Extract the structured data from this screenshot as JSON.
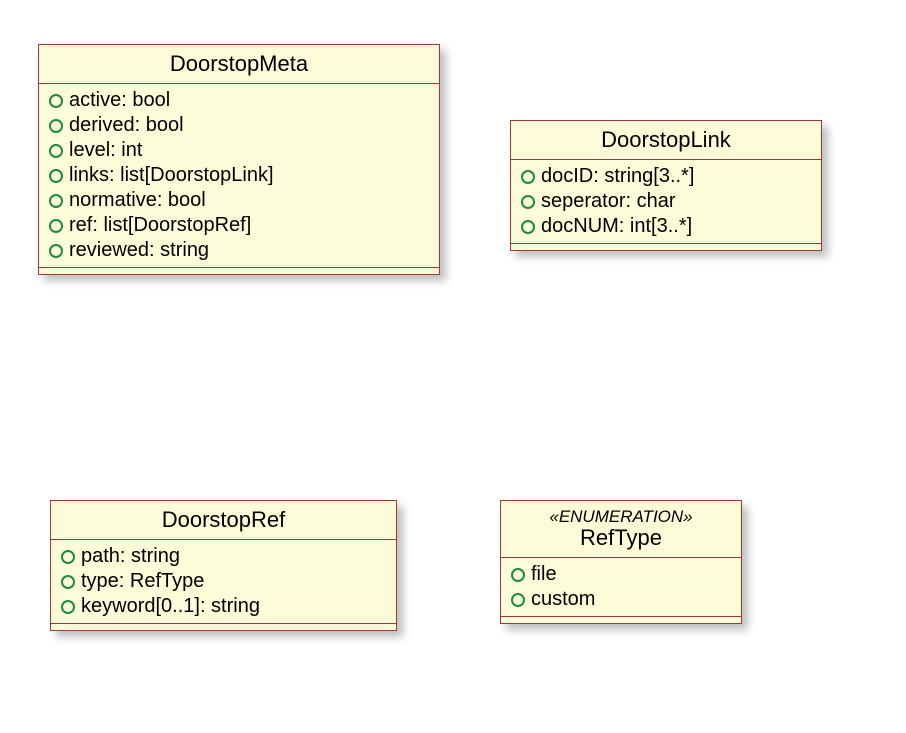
{
  "classes": {
    "meta": {
      "name": "DoorstopMeta",
      "attrs": [
        "active: bool",
        "derived: bool",
        "level: int",
        "links: list[DoorstopLink]",
        "normative: bool",
        "ref: list[DoorstopRef]",
        "reviewed: string"
      ]
    },
    "link": {
      "name": "DoorstopLink",
      "attrs": [
        "docID: string[3..*]",
        "seperator: char",
        "docNUM: int[3..*]"
      ]
    },
    "ref": {
      "name": "DoorstopRef",
      "attrs": [
        "path: string",
        "type: RefType",
        "keyword[0..1]: string"
      ]
    },
    "reftype": {
      "stereotype": "«ENUMERATION»",
      "name": "RefType",
      "attrs": [
        "file",
        "custom"
      ]
    }
  }
}
